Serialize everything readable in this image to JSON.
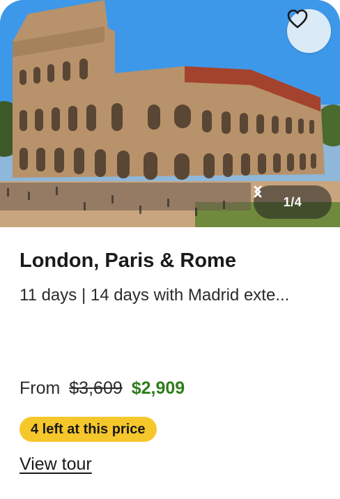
{
  "card": {
    "image": {
      "subject": "colosseum-photo",
      "slide_current": 1,
      "slide_total": 4,
      "pager_text": "1/4"
    },
    "favorite_icon": "heart-outline-icon",
    "title": "London, Paris & Rome",
    "subtitle": "11 days | 14 days with Madrid exte...",
    "price": {
      "from_label": "From",
      "original": "$3,609",
      "sale": "$2,909"
    },
    "badge": "4 left at this price",
    "cta": "View tour"
  },
  "colors": {
    "sale_price": "#2f7d1c",
    "badge_bg": "#f6c72b",
    "fav_button_bg": "#dbeaf7"
  }
}
